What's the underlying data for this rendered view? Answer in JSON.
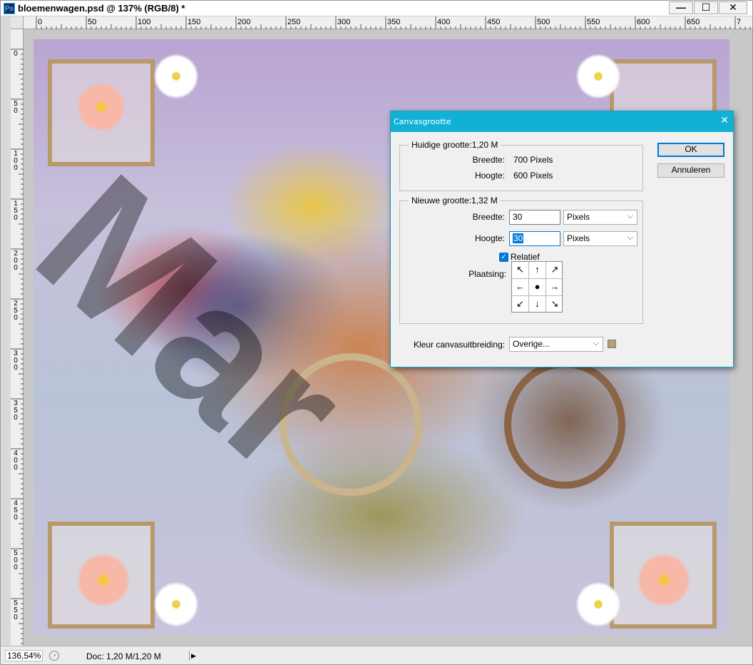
{
  "window": {
    "app_icon": "Ps",
    "title": "bloemenwagen.psd @ 137% (RGB/8) *",
    "min_label": "—",
    "max_label": "☐",
    "close_label": "✕"
  },
  "ruler_top_labels": [
    "0",
    "50",
    "100",
    "150",
    "200",
    "250",
    "300",
    "350",
    "400",
    "450",
    "500",
    "550",
    "600",
    "650",
    "7"
  ],
  "ruler_left_labels": [
    "0",
    "5\n0",
    "1\n0\n0",
    "1\n5\n0",
    "2\n0\n0",
    "2\n5\n0",
    "3\n0\n0",
    "3\n5\n0",
    "4\n0\n0",
    "4\n5\n0",
    "5\n0\n0",
    "5\n5\n0",
    "6"
  ],
  "statusbar": {
    "zoom": "136,54%",
    "doc": "Doc: 1,20 M/1,20 M",
    "arrow": "▶"
  },
  "dialog": {
    "title": "Canvasgrootte",
    "close": "✕",
    "current_legend": "Huidige grootte:1,20 M",
    "width_label": "Breedte:",
    "width_value": "700 Pixels",
    "height_label": "Hoogte:",
    "height_value": "600 Pixels",
    "new_legend": "Nieuwe grootte:1,32 M",
    "new_width_label": "Breedte:",
    "new_width_value": "30",
    "new_width_unit": "Pixels",
    "new_height_label": "Hoogte:",
    "new_height_value": "30",
    "new_height_unit": "Pixels",
    "relative_label": "Relatief",
    "relative_checked": true,
    "anchor_label": "Plaatsing:",
    "anchor_arrows": [
      "↖",
      "↑",
      "↗",
      "←",
      "●",
      "→",
      "↙",
      "↓",
      "↘"
    ],
    "extension_color_label": "Kleur canvasuitbreiding:",
    "extension_color_value": "Overige...",
    "extension_color_swatch": "#b59e74",
    "ok_label": "OK",
    "cancel_label": "Annuleren"
  },
  "watermark_text": "Mar",
  "colors": {
    "dialog_title_bg": "#11b1d6",
    "accent": "#0078d7"
  }
}
